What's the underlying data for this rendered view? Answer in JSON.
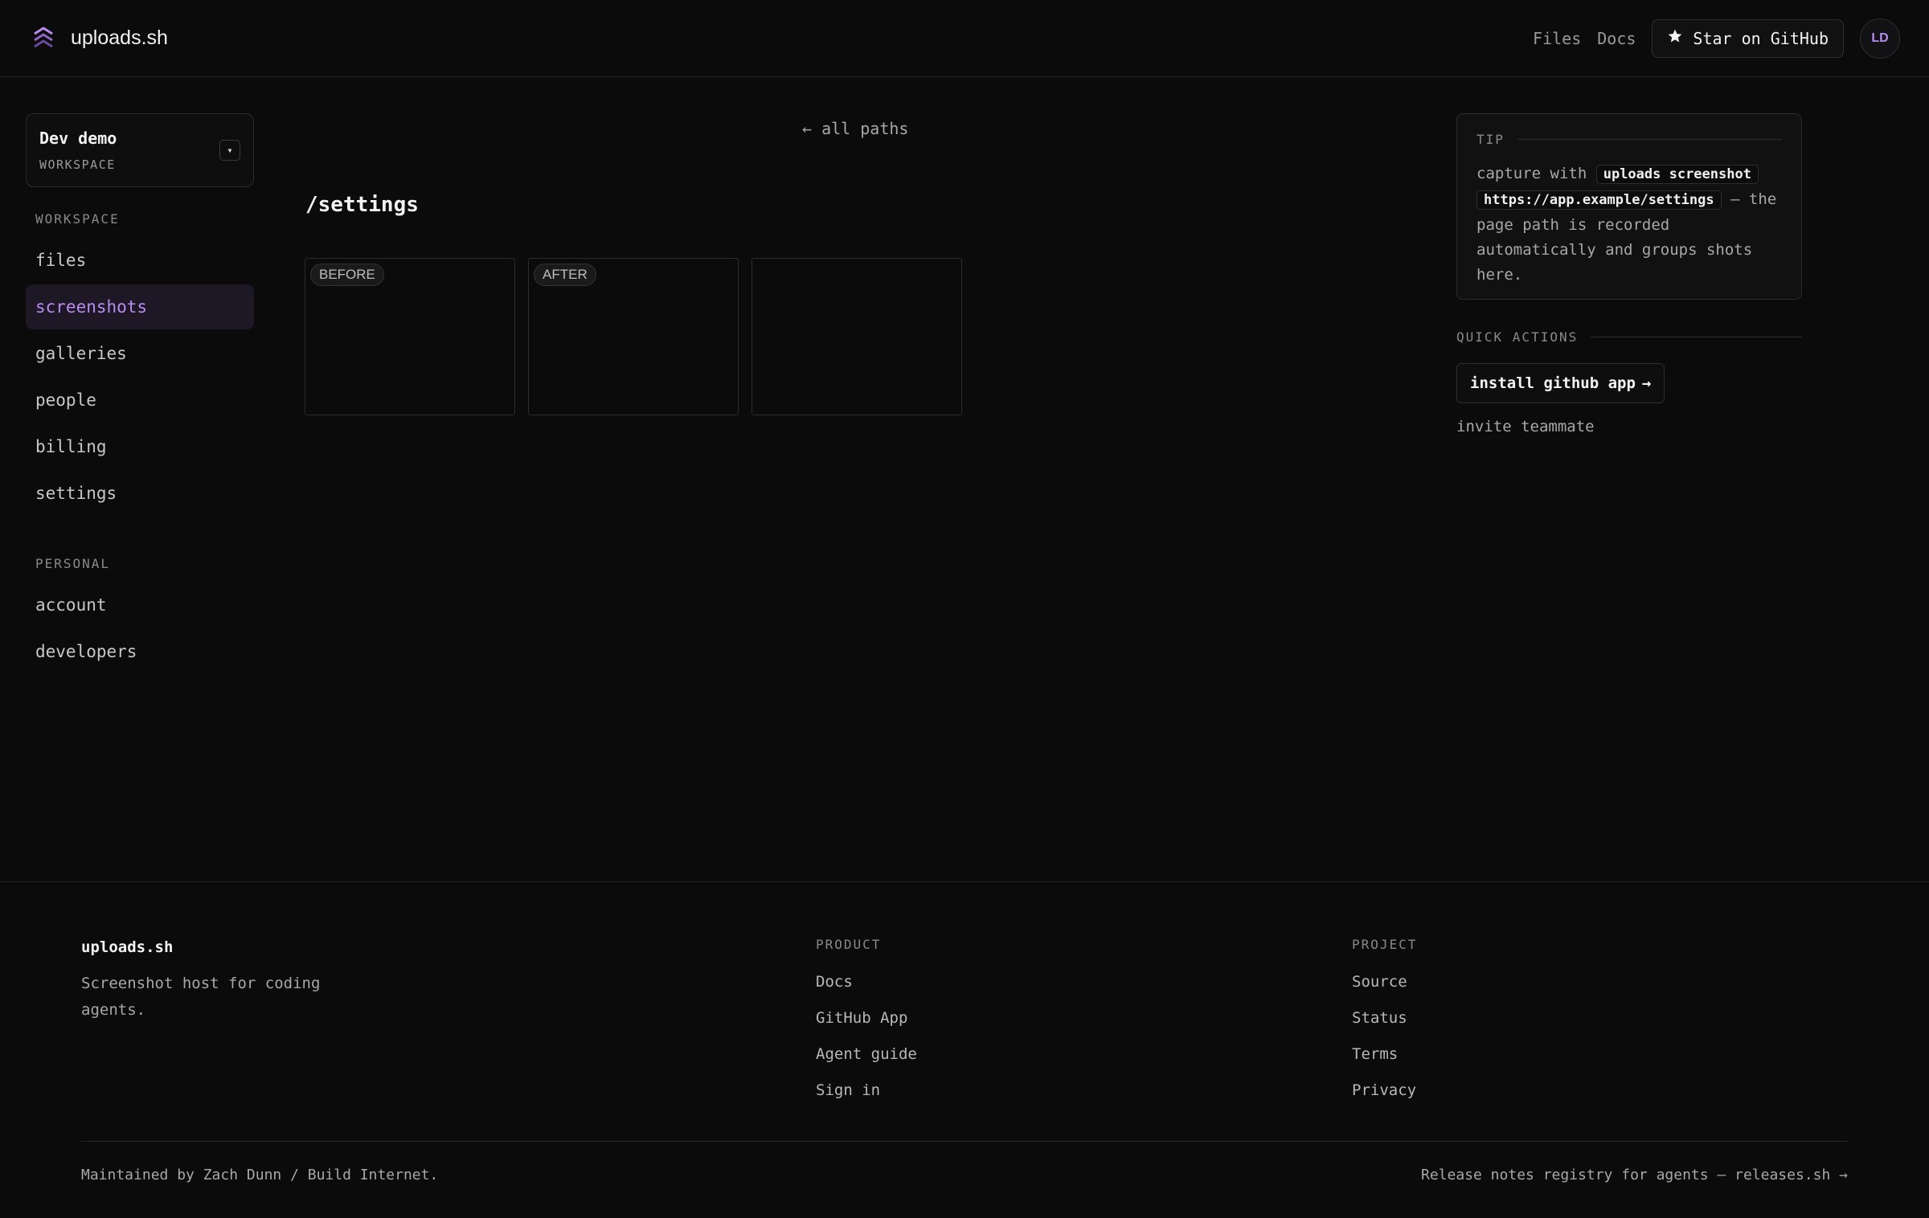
{
  "header": {
    "brand": "uploads.sh",
    "nav": {
      "files": "Files",
      "docs": "Docs"
    },
    "github_button": "Star on GitHub",
    "avatar_initials": "LD"
  },
  "sidebar": {
    "workspace_name": "Dev demo",
    "workspace_label": "WORKSPACE",
    "caret": "▾",
    "workspace_section": "WORKSPACE",
    "workspace_items": [
      "files",
      "screenshots",
      "galleries",
      "people",
      "billing",
      "settings"
    ],
    "active_item": "screenshots",
    "personal_section": "PERSONAL",
    "personal_items": [
      "account",
      "developers"
    ]
  },
  "main": {
    "back_link": "← all paths",
    "title": "/settings",
    "shots": [
      {
        "badge": "BEFORE"
      },
      {
        "badge": "AFTER"
      },
      {
        "badge": ""
      }
    ]
  },
  "tip": {
    "heading": "TIP",
    "prefix": "capture with ",
    "code_1": "uploads screenshot",
    "code_2": "https://app.example/settings",
    "suffix": " — the page path is recorded automatically and groups shots here."
  },
  "quick_actions": {
    "heading": "QUICK ACTIONS",
    "install_button": "install github app",
    "install_arrow": "→",
    "invite_link": "invite teammate"
  },
  "footer": {
    "brand": "uploads.sh",
    "tagline": "Screenshot host for coding agents.",
    "product_heading": "PRODUCT",
    "product_items": [
      "Docs",
      "GitHub App",
      "Agent guide",
      "Sign in"
    ],
    "project_heading": "PROJECT",
    "project_items": [
      "Source",
      "Status",
      "Terms",
      "Privacy"
    ],
    "maintained": "Maintained by Zach Dunn / Build Internet.",
    "releases": "Release notes registry for agents — releases.sh →"
  },
  "colors": {
    "background": "#0b0b0c",
    "accent": "#b98cf0",
    "active_bg": "#1d1726"
  }
}
